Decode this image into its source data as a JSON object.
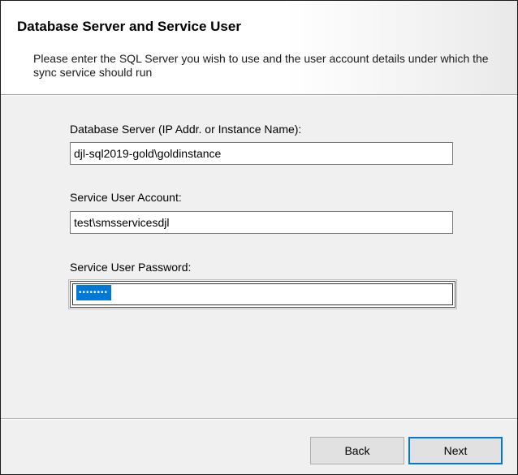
{
  "dialog": {
    "title": "Database Server and Service User",
    "subtitle": "Please enter the SQL Server you wish to use and the user account details under which the sync service should run"
  },
  "fields": {
    "database_server": {
      "label": "Database Server (IP Addr. or Instance Name):",
      "value": "djl-sql2019-gold\\goldinstance"
    },
    "service_user_account": {
      "label": "Service User Account:",
      "value": "test\\smsservicesdjl"
    },
    "service_user_password": {
      "label": "Service User Password:",
      "masked_value": "••••••••"
    }
  },
  "buttons": {
    "back": "Back",
    "next": "Next"
  },
  "colors": {
    "selection": "#0078d7",
    "default_button_border": "#0078d7",
    "panel": "#f0f0f0"
  }
}
